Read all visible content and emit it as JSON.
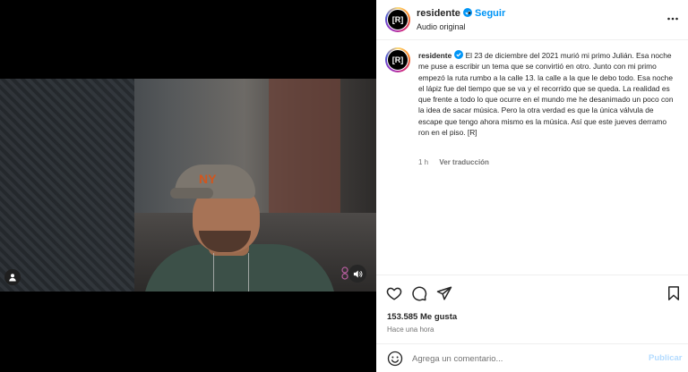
{
  "post": {
    "username": "residente",
    "avatar_text": "[R]",
    "follow_label": "Seguir",
    "separator": "•",
    "audio_label": "Audio original",
    "caption_user": "residente",
    "caption_text": "El 23 de diciembre del 2021 murió mi primo Julián. Esa noche me puse a escribir un tema que se convirtió en otro. Junto con mi primo empezó la ruta rumbo a la calle 13. la calle a la que le debo todo. Esa noche el lápiz fue del tiempo que se va y el recorrido que se queda. La realidad es que frente a todo lo que ocurre en el mundo me he desanimado un poco con la idea de sacar música. Pero la otra verdad es que la única válvula de escape que tengo ahora mismo es la música. Así que este jueves derramo ron en el piso. [R]",
    "caption_age": "1 h",
    "translate_label": "Ver traducción",
    "likes": "153.585 Me gusta",
    "posted_time": "Hace una hora"
  },
  "comment_box": {
    "placeholder": "Agrega un comentario...",
    "publish_label": "Publicar"
  },
  "icons": {
    "verified": "verified-badge-icon",
    "more": "more-options-icon",
    "like": "heart-icon",
    "comment": "comment-icon",
    "share": "share-icon",
    "save": "bookmark-icon",
    "emoji": "emoji-icon",
    "tagged": "user-tag-icon",
    "sound": "volume-icon"
  },
  "colors": {
    "link_blue": "#0095f6",
    "publish_disabled": "#b3dbff",
    "verified": "#0095f6",
    "text_primary": "#262626",
    "text_secondary": "#737373"
  }
}
